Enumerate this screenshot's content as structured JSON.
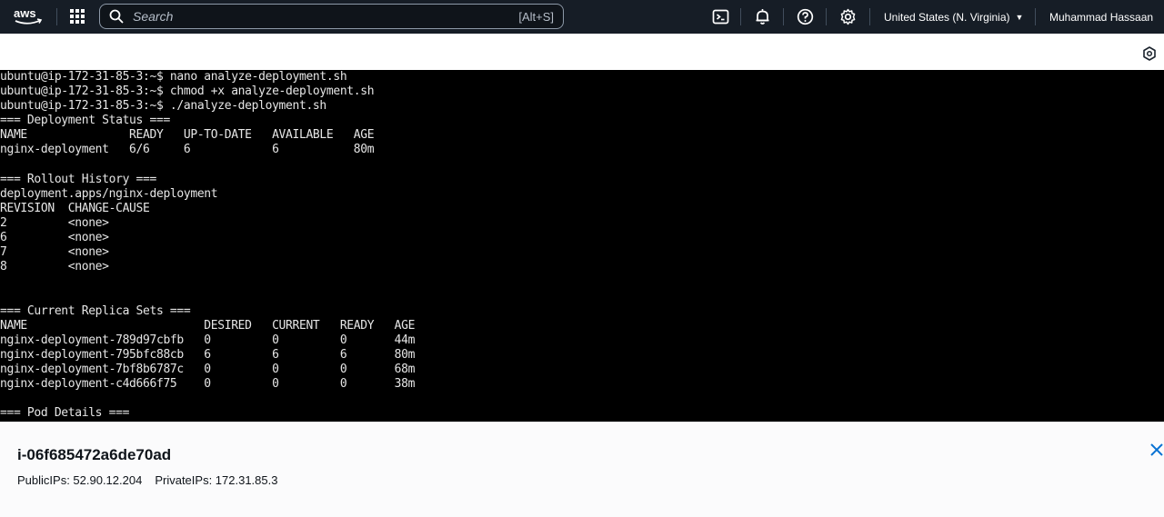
{
  "topnav": {
    "logo": "aws",
    "search_placeholder": "Search",
    "search_shortcut": "[Alt+S]",
    "icons": [
      "cloudshell-icon",
      "bell-icon",
      "help-icon",
      "gear-icon"
    ],
    "region": "United States (N. Virginia)",
    "user": "Muhammad Hassaan",
    "background": "#161d26"
  },
  "terminal": {
    "lines": [
      "ubuntu@ip-172-31-85-3:~$ nano analyze-deployment.sh",
      "ubuntu@ip-172-31-85-3:~$ chmod +x analyze-deployment.sh",
      "ubuntu@ip-172-31-85-3:~$ ./analyze-deployment.sh",
      "=== Deployment Status ===",
      "NAME               READY   UP-TO-DATE   AVAILABLE   AGE",
      "nginx-deployment   6/6     6            6           80m",
      "",
      "=== Rollout History ===",
      "deployment.apps/nginx-deployment",
      "REVISION  CHANGE-CAUSE",
      "2         <none>",
      "6         <none>",
      "7         <none>",
      "8         <none>",
      "",
      "",
      "=== Current Replica Sets ===",
      "NAME                          DESIRED   CURRENT   READY   AGE",
      "nginx-deployment-789d97cbfb   0         0         0       44m",
      "nginx-deployment-795bfc88cb   6         6         6       80m",
      "nginx-deployment-7bf8b6787c   0         0         0       68m",
      "nginx-deployment-c4d666f75    0         0         0       38m",
      "",
      "=== Pod Details ==="
    ]
  },
  "instance": {
    "id": "i-06f685472a6de70ad",
    "public_ips": "PublicIPs: 52.90.12.204",
    "private_ips": "PrivateIPs: 172.31.85.3"
  }
}
